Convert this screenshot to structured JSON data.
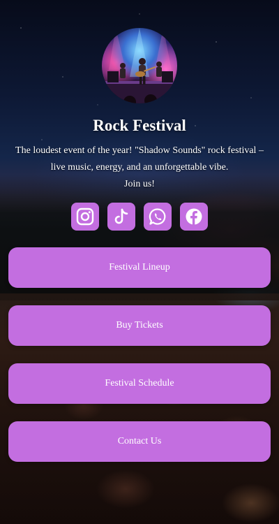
{
  "profile": {
    "title": "Rock Festival",
    "description_lines": [
      "The loudest event of the year! \"Shadow Sounds\" rock festival –",
      "live music, energy, and an unforgettable vibe.",
      "Join us!"
    ],
    "avatar_icon": "concert-photo"
  },
  "socials": [
    {
      "name": "Instagram",
      "icon": "instagram-icon"
    },
    {
      "name": "TikTok",
      "icon": "tiktok-icon"
    },
    {
      "name": "WhatsApp",
      "icon": "whatsapp-icon"
    },
    {
      "name": "Facebook",
      "icon": "facebook-icon"
    }
  ],
  "links": [
    {
      "label": "Festival Lineup"
    },
    {
      "label": "Buy Tickets"
    },
    {
      "label": "Festival Schedule"
    },
    {
      "label": "Contact Us"
    }
  ],
  "colors": {
    "accent": "#c36ee0",
    "text": "#ffffff",
    "background": "#0b1226"
  }
}
